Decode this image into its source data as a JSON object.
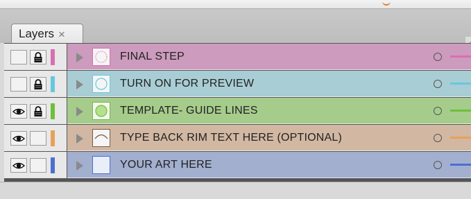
{
  "panel": {
    "tab_label": "Layers",
    "tab_close_icon": "close-icon"
  },
  "layers": [
    {
      "name": "FINAL STEP",
      "visible": false,
      "locked": true,
      "color": "#d86fb0",
      "bg": "#cc9bbd",
      "thumb_border": "#d86fb0",
      "thumb_shape": "circle-dotted",
      "sel_color": "#d86fb0"
    },
    {
      "name": "TURN ON FOR PREVIEW",
      "visible": false,
      "locked": true,
      "color": "#67c8dc",
      "bg": "#a9cdd4",
      "thumb_border": "#67c8dc",
      "thumb_shape": "circle",
      "sel_color": "#67c8dc"
    },
    {
      "name": "TEMPLATE- GUIDE LINES",
      "visible": true,
      "locked": true,
      "color": "#6fbf3a",
      "bg": "#a6cc8c",
      "thumb_border": "#6fbf3a",
      "thumb_shape": "circle-filled",
      "sel_color": "#6fbf3a"
    },
    {
      "name": "TYPE BACK RIM TEXT HERE (OPTIONAL)",
      "visible": true,
      "locked": false,
      "color": "#e6a25a",
      "bg": "#d2b8a2",
      "thumb_border": "#7a5a40",
      "thumb_shape": "arc",
      "sel_color": "#e6a25a"
    },
    {
      "name": "YOUR ART HERE",
      "visible": true,
      "locked": false,
      "color": "#4b6fd0",
      "bg": "#a2afcf",
      "thumb_border": "#4b6fd0",
      "thumb_shape": "blank",
      "sel_color": "#4b6fd0"
    }
  ]
}
